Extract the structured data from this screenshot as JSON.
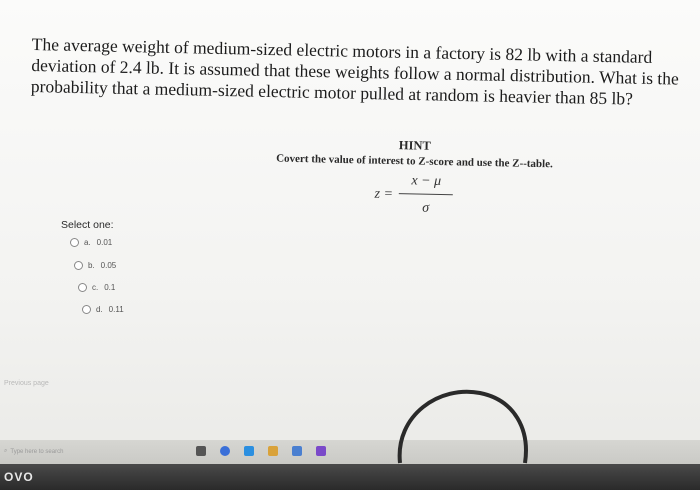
{
  "question": {
    "line1": "The average weight of medium-sized electric motors in a factory is 82 lb with a standard",
    "line2": "deviation of 2.4 lb. It is assumed that these weights follow a normal distribution. What is the",
    "line3": "probability that a medium-sized electric motor pulled at random is heavier than 85 lb?"
  },
  "hint": {
    "title": "HINT",
    "text": "Covert the value of interest to Z-score and use the Z--table.",
    "formula_lhs": "z =",
    "formula_num": "x − μ",
    "formula_den": "σ"
  },
  "quiz": {
    "select_label": "Select one:",
    "options": [
      {
        "letter": "a.",
        "value": "0.01"
      },
      {
        "letter": "b.",
        "value": "0.05"
      },
      {
        "letter": "c.",
        "value": "0.1"
      },
      {
        "letter": "d.",
        "value": "0.11"
      }
    ]
  },
  "nav": {
    "previous": "Previous page"
  },
  "taskbar": {
    "search_placeholder": "Type here to search"
  },
  "device": {
    "brand": "OVO"
  },
  "colors": {
    "taskbar_icon_1": "#3a6fd8",
    "taskbar_icon_2": "#2b8fe0",
    "taskbar_icon_3": "#d9a23a",
    "taskbar_icon_4": "#7a49c9"
  }
}
